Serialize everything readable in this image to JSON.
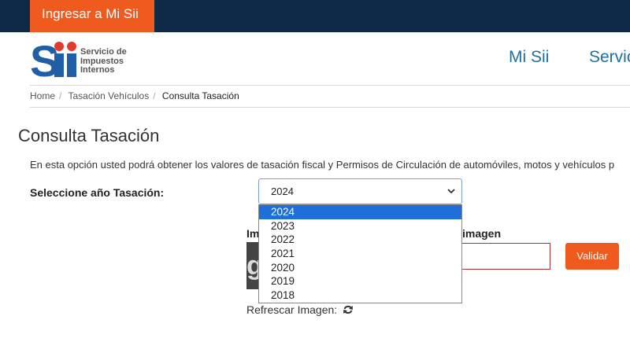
{
  "topbar": {
    "login_label": "Ingresar a Mi Sii"
  },
  "header": {
    "logo_lines": [
      "Servicio de",
      "Impuestos",
      "Internos"
    ],
    "nav": [
      "Mi Sii",
      "Servic"
    ]
  },
  "breadcrumb": [
    "Home",
    "Tasación Vehículos",
    "Consulta Tasación"
  ],
  "main": {
    "title": "Consulta Tasación",
    "intro": "En esta opción usted podrá obtener los valores de tasación fiscal y Permisos de Circulación de automóviles, motos y vehículos p",
    "year_label": "Seleccione año Tasación:",
    "year_selected": "2024",
    "year_options": [
      "2024",
      "2023",
      "2022",
      "2021",
      "2020",
      "2019",
      "2018"
    ],
    "image_label_left": "Im",
    "image_label_right": "imagen",
    "validate_label": "Validar",
    "refresh_label": "Refrescar Imagen:"
  },
  "colors": {
    "topbar": "#0e2a47",
    "accent": "#ef5a1f",
    "link": "#1e6fa6",
    "logo": "#1e5fa8",
    "selected_option": "#1e6fd9"
  }
}
